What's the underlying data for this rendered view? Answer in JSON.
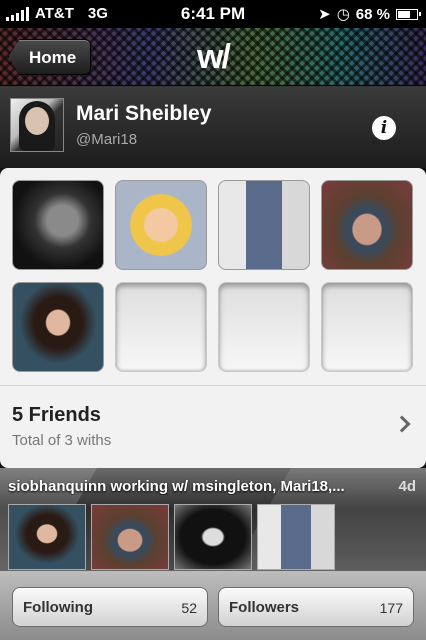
{
  "status_bar": {
    "carrier": "AT&T",
    "network": "3G",
    "time": "6:41 PM",
    "battery_text": "68 %",
    "battery_level": 0.68,
    "icons": [
      "signal-icon",
      "location-arrow-icon",
      "clock-icon",
      "battery-icon"
    ]
  },
  "nav": {
    "back_label": "Home",
    "logo": "w/"
  },
  "profile": {
    "name": "Mari Sheibley",
    "handle": "@Mari18",
    "info_icon": "i"
  },
  "friends": {
    "tiles": [
      {
        "filled": true,
        "subject": "man-bw-portrait"
      },
      {
        "filled": true,
        "subject": "cartoon-doll"
      },
      {
        "filled": true,
        "subject": "man-grey-jacket"
      },
      {
        "filled": true,
        "subject": "man-baseball-cap"
      },
      {
        "filled": true,
        "subject": "woman-smiling"
      },
      {
        "filled": false
      },
      {
        "filled": false
      },
      {
        "filled": false
      }
    ],
    "title": "5 Friends",
    "subtitle": "Total of 3 withs"
  },
  "activity": {
    "title": "siobhanquinn working w/ msingleton, Mari18,...",
    "age": "4d"
  },
  "footer": {
    "following_label": "Following",
    "following_count": "52",
    "followers_label": "Followers",
    "followers_count": "177"
  },
  "colors": {
    "card_background": "#f2f2f2",
    "header_dark": "#1c1c1c",
    "footer_gray": "#a5a5a5"
  }
}
